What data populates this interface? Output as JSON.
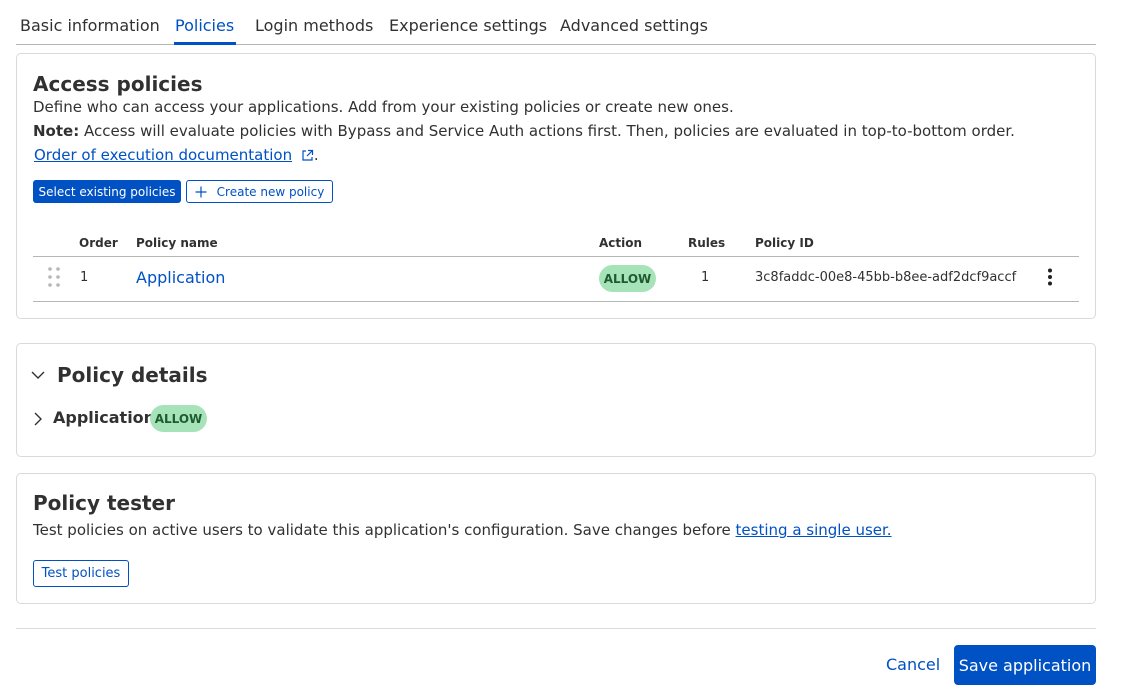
{
  "tabs": [
    {
      "label": "Basic information"
    },
    {
      "label": "Policies"
    },
    {
      "label": "Login methods"
    },
    {
      "label": "Experience settings"
    },
    {
      "label": "Advanced settings"
    }
  ],
  "access_policies": {
    "title": "Access policies",
    "description": "Define who can access your applications. Add from your existing policies or create new ones.",
    "note_label": "Note:",
    "note_text": " Access will evaluate policies with Bypass and Service Auth actions first. Then, policies are evaluated in top-to-bottom order.",
    "doc_link": "Order of execution documentation",
    "doc_link_suffix": ".",
    "select_button": "Select existing policies",
    "create_button": "Create new policy",
    "table": {
      "columns": [
        "Order",
        "Policy name",
        "Action",
        "Rules",
        "Policy ID"
      ],
      "rows": [
        {
          "order": "1",
          "name": "Application",
          "action": "ALLOW",
          "rules": "1",
          "policy_id": "3c8faddc-00e8-45bb-b8ee-adf2dcf9accf"
        }
      ]
    }
  },
  "policy_details": {
    "title": "Policy details",
    "items": [
      {
        "name": "Application",
        "action": "ALLOW"
      }
    ]
  },
  "policy_tester": {
    "title": "Policy tester",
    "description": "Test policies on active users to validate this application's configuration. Save changes before ",
    "link": "testing a single user.",
    "button": "Test policies"
  },
  "footer": {
    "cancel": "Cancel",
    "save": "Save application"
  },
  "colors": {
    "accent": "#0051c3",
    "allow_badge_bg": "#a7e3b8",
    "allow_badge_text": "#1e5b30"
  },
  "icons": {
    "drag": "drag-handle-icon",
    "more": "more-vertical-icon",
    "external": "external-link-icon",
    "plus": "plus-icon",
    "chevron_down": "chevron-down-icon",
    "chevron_right": "chevron-right-icon"
  }
}
